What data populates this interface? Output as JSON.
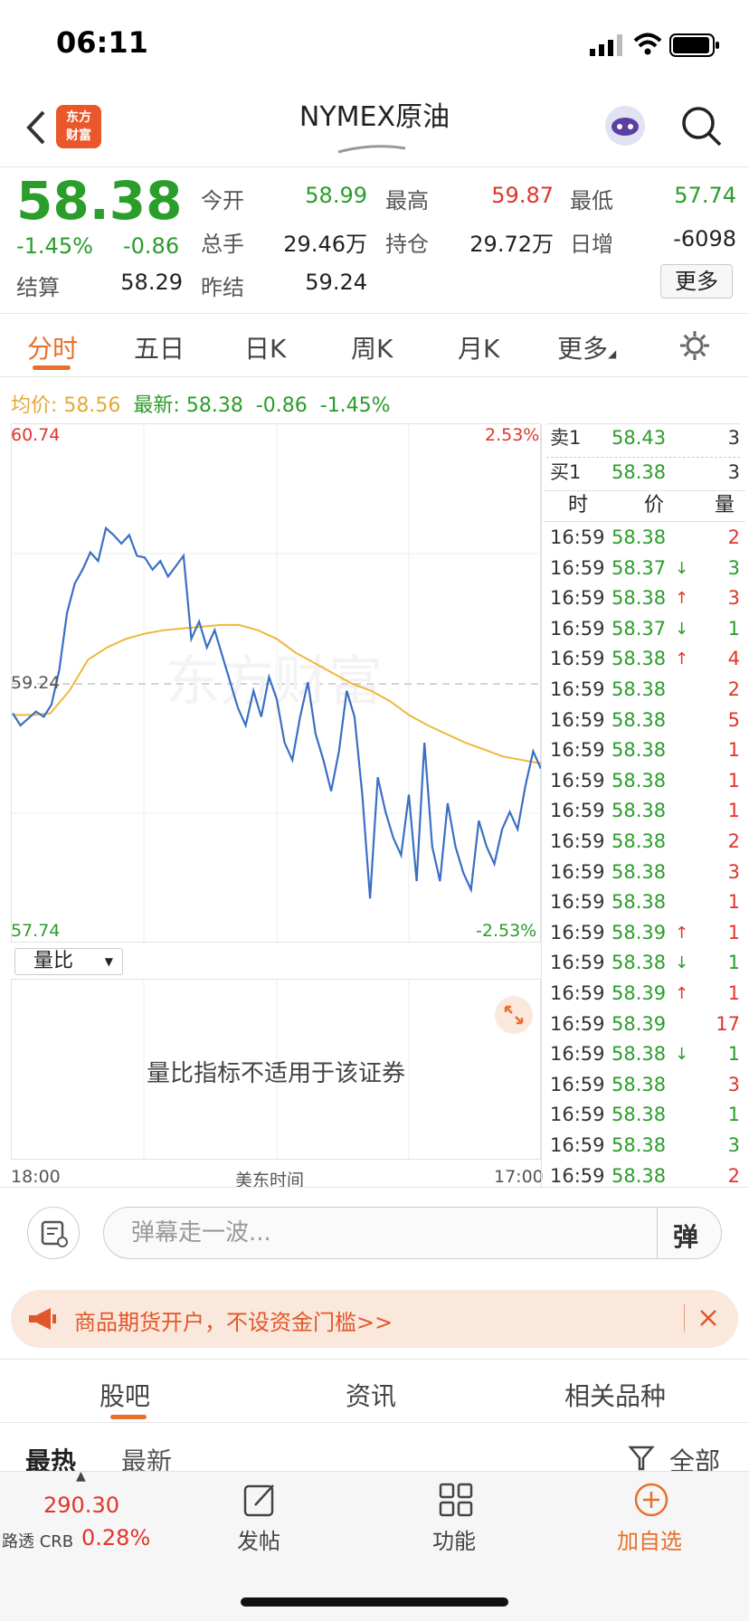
{
  "status": {
    "time": "06:11"
  },
  "nav": {
    "title": "NYMEX原油",
    "logo_line1": "东方",
    "logo_line2": "财富"
  },
  "quote": {
    "price": "58.38",
    "change_pct": "-1.45%",
    "change": "-0.86",
    "open_label": "今开",
    "open": "58.99",
    "high_label": "最高",
    "high": "59.87",
    "low_label": "最低",
    "low": "57.74",
    "volume_label": "总手",
    "volume": "29.46万",
    "oi_label": "持仓",
    "oi": "29.72万",
    "daily_inc_label": "日增",
    "daily_inc": "-6098",
    "settle_label": "结算",
    "settle": "58.29",
    "prev_settle_label": "昨结",
    "prev_settle": "59.24",
    "more_label": "更多"
  },
  "tabs": [
    "分时",
    "五日",
    "日K",
    "周K",
    "月K",
    "更多"
  ],
  "avg_row": {
    "avg_label": "均价:",
    "avg_value": "58.56",
    "latest_label": "最新:",
    "latest_value": "58.38",
    "latest_change": "-0.86",
    "latest_pct": "-1.45%"
  },
  "chart_data": {
    "type": "line",
    "title": "",
    "xlabel": "美东时间",
    "x_start_label": "18:00",
    "x_end_label": "17:00",
    "ylim": [
      57.74,
      60.74
    ],
    "y_top_label": "60.74",
    "y_bottom_label": "57.74",
    "ref_line_label": "59.24",
    "pct_top_label": "2.53%",
    "pct_bottom_label": "-2.53%",
    "watermark": "东方财富",
    "series": [
      {
        "color": "#3a6fc4",
        "values": [
          59.07,
          59.0,
          59.04,
          59.08,
          59.05,
          59.12,
          59.32,
          59.65,
          59.82,
          59.9,
          60.0,
          59.95,
          60.14,
          60.1,
          60.05,
          60.1,
          59.98,
          59.97,
          59.9,
          59.95,
          59.86,
          59.92,
          59.98,
          59.5,
          59.6,
          59.45,
          59.55,
          59.4,
          59.25,
          59.1,
          59.0,
          59.2,
          59.05,
          59.28,
          59.15,
          58.9,
          58.8,
          59.05,
          59.25,
          58.95,
          58.8,
          58.62,
          58.85,
          59.2,
          59.05,
          58.6,
          58.0,
          58.7,
          58.5,
          58.35,
          58.25,
          58.6,
          58.1,
          58.9,
          58.3,
          58.1,
          58.55,
          58.3,
          58.15,
          58.05,
          58.45,
          58.3,
          58.2,
          58.4,
          58.5,
          58.4,
          58.65,
          58.85,
          58.75
        ]
      },
      {
        "color": "#f0b73b",
        "values": [
          59.06,
          59.06,
          59.07,
          59.2,
          59.38,
          59.45,
          59.5,
          59.53,
          59.55,
          59.56,
          59.57,
          59.58,
          59.58,
          59.55,
          59.5,
          59.42,
          59.36,
          59.3,
          59.24,
          59.2,
          59.14,
          59.06,
          59.0,
          58.95,
          58.9,
          58.86,
          58.82,
          58.8,
          58.78
        ]
      }
    ]
  },
  "volume_panel": {
    "selector_label": "量比",
    "message": "量比指标不适用于该证券"
  },
  "order_book": {
    "ask": {
      "label": "卖1",
      "price": "58.43",
      "vol": "3"
    },
    "bid": {
      "label": "买1",
      "price": "58.38",
      "vol": "3"
    },
    "headers": [
      "时",
      "价",
      "量"
    ],
    "trades": [
      {
        "time": "16:59",
        "price": "58.38",
        "dir": "",
        "vol": "2",
        "vc": "red"
      },
      {
        "time": "16:59",
        "price": "58.37",
        "dir": "↓",
        "vol": "3",
        "vc": "green"
      },
      {
        "time": "16:59",
        "price": "58.38",
        "dir": "↑",
        "vol": "3",
        "vc": "red"
      },
      {
        "time": "16:59",
        "price": "58.37",
        "dir": "↓",
        "vol": "1",
        "vc": "green"
      },
      {
        "time": "16:59",
        "price": "58.38",
        "dir": "↑",
        "vol": "4",
        "vc": "red"
      },
      {
        "time": "16:59",
        "price": "58.38",
        "dir": "",
        "vol": "2",
        "vc": "red"
      },
      {
        "time": "16:59",
        "price": "58.38",
        "dir": "",
        "vol": "5",
        "vc": "red"
      },
      {
        "time": "16:59",
        "price": "58.38",
        "dir": "",
        "vol": "1",
        "vc": "red"
      },
      {
        "time": "16:59",
        "price": "58.38",
        "dir": "",
        "vol": "1",
        "vc": "red"
      },
      {
        "time": "16:59",
        "price": "58.38",
        "dir": "",
        "vol": "1",
        "vc": "red"
      },
      {
        "time": "16:59",
        "price": "58.38",
        "dir": "",
        "vol": "2",
        "vc": "red"
      },
      {
        "time": "16:59",
        "price": "58.38",
        "dir": "",
        "vol": "3",
        "vc": "red"
      },
      {
        "time": "16:59",
        "price": "58.38",
        "dir": "",
        "vol": "1",
        "vc": "red"
      },
      {
        "time": "16:59",
        "price": "58.39",
        "dir": "↑",
        "vol": "1",
        "vc": "red"
      },
      {
        "time": "16:59",
        "price": "58.38",
        "dir": "↓",
        "vol": "1",
        "vc": "green"
      },
      {
        "time": "16:59",
        "price": "58.39",
        "dir": "↑",
        "vol": "1",
        "vc": "red"
      },
      {
        "time": "16:59",
        "price": "58.39",
        "dir": "",
        "vol": "17",
        "vc": "red"
      },
      {
        "time": "16:59",
        "price": "58.38",
        "dir": "↓",
        "vol": "1",
        "vc": "green"
      },
      {
        "time": "16:59",
        "price": "58.38",
        "dir": "",
        "vol": "3",
        "vc": "red"
      },
      {
        "time": "16:59",
        "price": "58.38",
        "dir": "",
        "vol": "1",
        "vc": "green"
      },
      {
        "time": "16:59",
        "price": "58.38",
        "dir": "",
        "vol": "3",
        "vc": "green"
      },
      {
        "time": "16:59",
        "price": "58.38",
        "dir": "",
        "vol": "2",
        "vc": "red"
      }
    ]
  },
  "danmaku": {
    "placeholder": "弹幕走一波...",
    "send_label": "弹"
  },
  "promo": {
    "text": "商品期货开户，不设资金门槛>>"
  },
  "sub_tabs": [
    "股吧",
    "资讯",
    "相关品种"
  ],
  "sort": {
    "hot": "最热",
    "new": "最新",
    "filter": "全部"
  },
  "bottom": {
    "index_value": "290.30",
    "index_name": "路透 CRB",
    "index_pct": "0.28%",
    "post": "发帖",
    "func": "功能",
    "add": "加自选"
  }
}
